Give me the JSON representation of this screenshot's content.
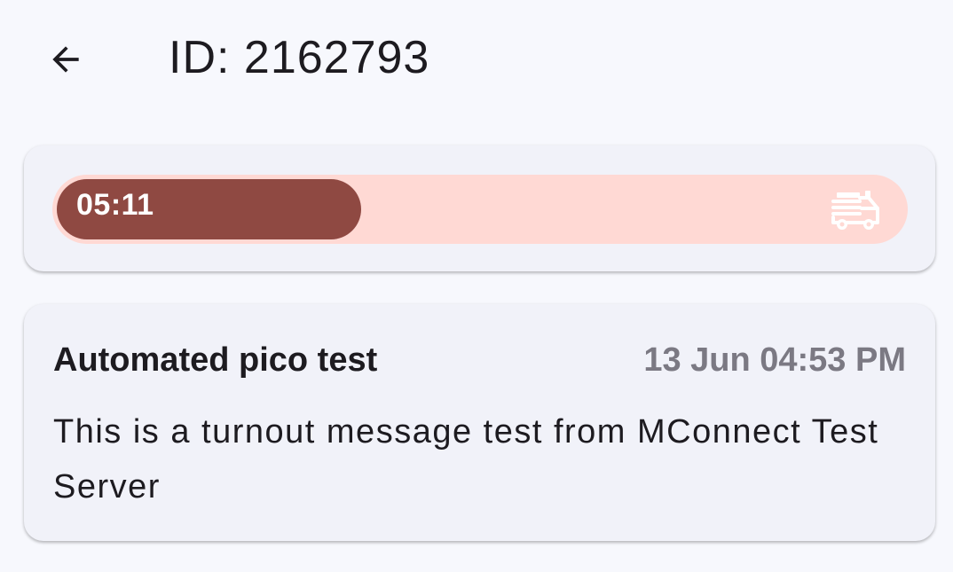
{
  "header": {
    "title": "ID: 2162793",
    "back_icon": "arrow-back-icon"
  },
  "status": {
    "timer": "05:11",
    "progress_fraction": 0.36,
    "icon": "fire-truck-icon",
    "colors": {
      "track": "#ffd9d4",
      "fill": "#8f4942"
    }
  },
  "message": {
    "title": "Automated pico test",
    "timestamp": "13 Jun 04:53 PM",
    "body": "This is a turnout message test from MConnect Test Server"
  }
}
